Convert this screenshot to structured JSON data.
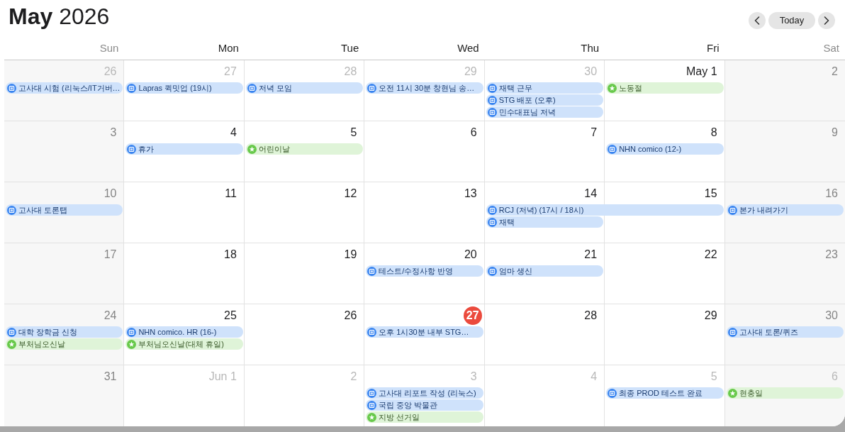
{
  "header": {
    "title": "**May** 2026",
    "today_button": "Today"
  },
  "weekdays": [
    {
      "label": "Sun",
      "weekend": true
    },
    {
      "label": "Mon",
      "weekend": false
    },
    {
      "label": "Tue",
      "weekend": false
    },
    {
      "label": "Wed",
      "weekend": false
    },
    {
      "label": "Thu",
      "weekend": false
    },
    {
      "label": "Fri",
      "weekend": false
    },
    {
      "label": "Sat",
      "weekend": true
    }
  ],
  "weeks": [
    {
      "days": [
        {
          "label": "26",
          "in_month": false,
          "today": false,
          "events": [
            {
              "title": "고사대 시험 (리눅스/IT거버…",
              "kind": "event",
              "multi_day": false
            }
          ]
        },
        {
          "label": "27",
          "in_month": false,
          "today": false,
          "events": [
            {
              "title": "Lapras 퀵밋업 (19시)",
              "kind": "event",
              "multi_day": false
            }
          ]
        },
        {
          "label": "28",
          "in_month": false,
          "today": false,
          "events": [
            {
              "title": "저녁 모임",
              "kind": "event",
              "multi_day": false
            }
          ]
        },
        {
          "label": "29",
          "in_month": false,
          "today": false,
          "events": [
            {
              "title": "오전 11시 30분 창현님 송…",
              "kind": "event",
              "multi_day": false
            }
          ]
        },
        {
          "label": "30",
          "in_month": false,
          "today": false,
          "events": [
            {
              "title": "재택 근무",
              "kind": "event",
              "multi_day": false
            },
            {
              "title": "STG 배포 (오후)",
              "kind": "event",
              "multi_day": false
            },
            {
              "title": "민수대표님 저녁",
              "kind": "event",
              "multi_day": false
            }
          ]
        },
        {
          "label": "May 1",
          "in_month": true,
          "today": false,
          "events": [
            {
              "title": "노동절",
              "kind": "holiday",
              "multi_day": false
            }
          ]
        },
        {
          "label": "2",
          "in_month": true,
          "today": false
        }
      ]
    },
    {
      "days": [
        {
          "label": "3",
          "in_month": true,
          "today": false
        },
        {
          "label": "4",
          "in_month": true,
          "today": false,
          "events": [
            {
              "title": "휴가",
              "kind": "event",
              "multi_day": false
            }
          ]
        },
        {
          "label": "5",
          "in_month": true,
          "today": false,
          "events": [
            {
              "title": "어린이날",
              "kind": "holiday",
              "multi_day": false
            }
          ]
        },
        {
          "label": "6",
          "in_month": true,
          "today": false
        },
        {
          "label": "7",
          "in_month": true,
          "today": false
        },
        {
          "label": "8",
          "in_month": true,
          "today": false,
          "events": [
            {
              "title": "NHN comico (12-)",
              "kind": "event",
              "multi_day": false
            }
          ]
        },
        {
          "label": "9",
          "in_month": true,
          "today": false
        }
      ]
    },
    {
      "days": [
        {
          "label": "10",
          "in_month": true,
          "today": false,
          "events": [
            {
              "title": "고사대 토론탭",
              "kind": "event",
              "multi_day": false
            }
          ]
        },
        {
          "label": "11",
          "in_month": true,
          "today": false
        },
        {
          "label": "12",
          "in_month": true,
          "today": false
        },
        {
          "label": "13",
          "in_month": true,
          "today": false
        },
        {
          "label": "14",
          "in_month": true,
          "today": false,
          "events": [
            {
              "title": "RCJ (저녁) (17시 / 18시)",
              "kind": "event",
              "multi_day": true
            },
            {
              "title": "재택",
              "kind": "event",
              "multi_day": false
            }
          ]
        },
        {
          "label": "15",
          "in_month": true,
          "today": false
        },
        {
          "label": "16",
          "in_month": true,
          "today": false,
          "events": [
            {
              "title": "본가 내려가기",
              "kind": "event",
              "multi_day": false
            }
          ]
        }
      ]
    },
    {
      "days": [
        {
          "label": "17",
          "in_month": true,
          "today": false
        },
        {
          "label": "18",
          "in_month": true,
          "today": false
        },
        {
          "label": "19",
          "in_month": true,
          "today": false
        },
        {
          "label": "20",
          "in_month": true,
          "today": false,
          "events": [
            {
              "title": "테스트/수정사항 반영",
              "kind": "event",
              "multi_day": false
            }
          ]
        },
        {
          "label": "21",
          "in_month": true,
          "today": false,
          "events": [
            {
              "title": "엄마 생신",
              "kind": "event",
              "multi_day": false
            }
          ]
        },
        {
          "label": "22",
          "in_month": true,
          "today": false
        },
        {
          "label": "23",
          "in_month": true,
          "today": false
        }
      ]
    },
    {
      "days": [
        {
          "label": "24",
          "in_month": true,
          "today": false,
          "events": [
            {
              "title": "대학 장학금 신청",
              "kind": "event",
              "multi_day": false
            },
            {
              "title": "부처님오신날",
              "kind": "holiday",
              "multi_day": false
            }
          ]
        },
        {
          "label": "25",
          "in_month": true,
          "today": false,
          "events": [
            {
              "title": "NHN comico. HR (16-)",
              "kind": "event",
              "multi_day": false
            },
            {
              "title": "부처님오신날(대체 휴일)",
              "kind": "holiday",
              "multi_day": false
            }
          ]
        },
        {
          "label": "26",
          "in_month": true,
          "today": false
        },
        {
          "label": "27",
          "in_month": true,
          "today": true,
          "events": [
            {
              "title": "오후 1시30분 내부 STG…",
              "kind": "event",
              "multi_day": false
            }
          ]
        },
        {
          "label": "28",
          "in_month": true,
          "today": false
        },
        {
          "label": "29",
          "in_month": true,
          "today": false
        },
        {
          "label": "30",
          "in_month": true,
          "today": false,
          "events": [
            {
              "title": "고사대 토론/퀴즈",
              "kind": "event",
              "multi_day": false
            }
          ]
        }
      ]
    },
    {
      "days": [
        {
          "label": "31",
          "in_month": true,
          "today": false
        },
        {
          "label": "Jun 1",
          "in_month": false,
          "today": false
        },
        {
          "label": "2",
          "in_month": false,
          "today": false
        },
        {
          "label": "3",
          "in_month": false,
          "today": false,
          "events": [
            {
              "title": "고사대 리포트 작성 (리눅스)",
              "kind": "event",
              "multi_day": false
            },
            {
              "title": "국립 중앙 박물관",
              "kind": "event",
              "multi_day": false
            },
            {
              "title": "지방 선거일",
              "kind": "holiday",
              "multi_day": false
            }
          ]
        },
        {
          "label": "4",
          "in_month": false,
          "today": false
        },
        {
          "label": "5",
          "in_month": false,
          "today": false,
          "events": [
            {
              "title": "최종 PROD 테스트 완료",
              "kind": "event",
              "multi_day": false
            }
          ]
        },
        {
          "label": "6",
          "in_month": false,
          "today": false,
          "events": [
            {
              "title": "현충일",
              "kind": "holiday",
              "multi_day": false
            }
          ]
        }
      ]
    }
  ]
}
